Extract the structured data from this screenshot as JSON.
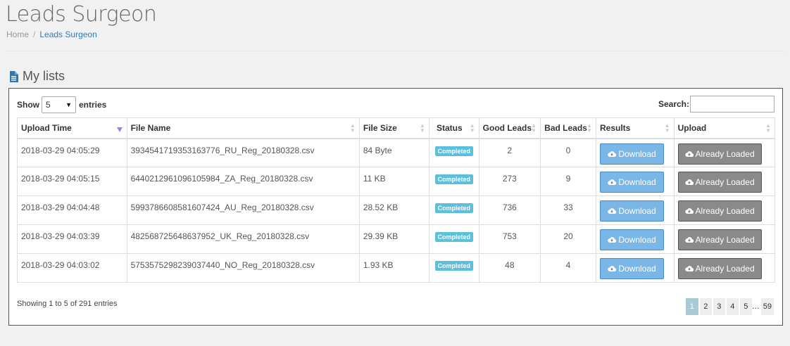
{
  "page": {
    "title": "Leads Surgeon"
  },
  "breadcrumb": {
    "home": "Home",
    "current": "Leads Surgeon"
  },
  "section": {
    "title": "My lists",
    "icon": "file-text-icon"
  },
  "length": {
    "show": "Show",
    "value": "5",
    "entries": "entries"
  },
  "search": {
    "label": "Search:",
    "value": ""
  },
  "table": {
    "headers": [
      "Upload Time",
      "File Name",
      "File Size",
      "Status",
      "Good Leads",
      "Bad Leads",
      "Results",
      "Upload"
    ],
    "rows": [
      {
        "time": "2018-03-29 04:05:29",
        "file": "3934541719353163776_RU_Reg_20180328.csv",
        "size": "84 Byte",
        "status": "Completed",
        "good": "2",
        "bad": "0",
        "result": "Download",
        "upload": "Already Loaded"
      },
      {
        "time": "2018-03-29 04:05:15",
        "file": "6440212961096105984_ZA_Reg_20180328.csv",
        "size": "11 KB",
        "status": "Completed",
        "good": "273",
        "bad": "9",
        "result": "Download",
        "upload": "Already Loaded"
      },
      {
        "time": "2018-03-29 04:04:48",
        "file": "5993786608581607424_AU_Reg_20180328.csv",
        "size": "28.52 KB",
        "status": "Completed",
        "good": "736",
        "bad": "33",
        "result": "Download",
        "upload": "Already Loaded"
      },
      {
        "time": "2018-03-29 04:03:39",
        "file": "482568725648637952_UK_Reg_20180328.csv",
        "size": "29.39 KB",
        "status": "Completed",
        "good": "753",
        "bad": "20",
        "result": "Download",
        "upload": "Already Loaded"
      },
      {
        "time": "2018-03-29 04:03:02",
        "file": "5753575298239037440_NO_Reg_20180328.csv",
        "size": "1.93 KB",
        "status": "Completed",
        "good": "48",
        "bad": "4",
        "result": "Download",
        "upload": "Already Loaded"
      }
    ]
  },
  "info": "Showing 1 to 5 of 291 entries",
  "pagination": {
    "pages": [
      "1",
      "2",
      "3",
      "4",
      "5"
    ],
    "ellipsis": "…",
    "last": "59",
    "active": "1"
  },
  "colors": {
    "badge": "#5bc0de",
    "download": "#7ab6e6",
    "loaded": "#8a8a8a",
    "link": "#337ab7"
  }
}
